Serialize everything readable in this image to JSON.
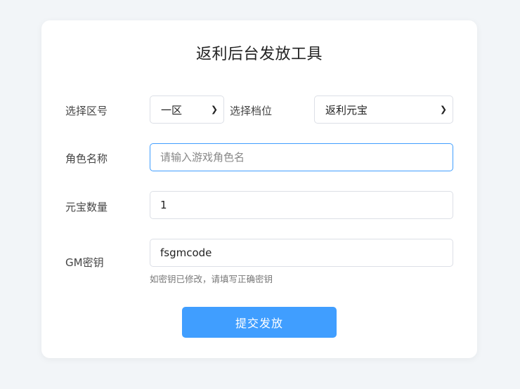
{
  "title": "返利后台发放工具",
  "zone": {
    "label": "选择区号",
    "value": "一区"
  },
  "tier": {
    "label": "选择档位",
    "value": "返利元宝"
  },
  "role": {
    "label": "角色名称",
    "placeholder": "请输入游戏角色名",
    "value": ""
  },
  "ingot": {
    "label": "元宝数量",
    "value": "1"
  },
  "gm": {
    "label": "GM密钥",
    "value": "fsgmcode",
    "hint": "如密钥已修改，请填写正确密钥"
  },
  "submit": {
    "label": "提交发放"
  },
  "colors": {
    "accent": "#409eff",
    "background": "#f2f5f8"
  },
  "icons": {
    "dropdown": "chevron-down-icon"
  }
}
